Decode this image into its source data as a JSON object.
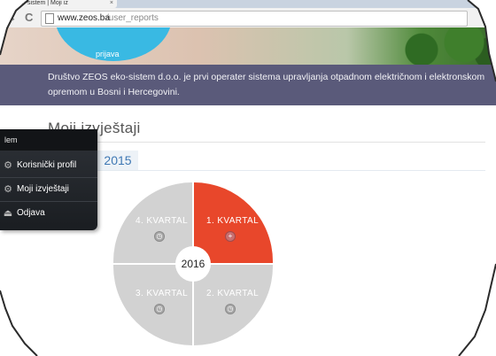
{
  "browser": {
    "tab_title": "s eko-sistem | Moji iz",
    "tab_close": "×",
    "back_glyph": "→",
    "reload_glyph": "C",
    "url_host": "www.zeos.ba",
    "url_path": "/user_reports"
  },
  "hero": {
    "circle_label": "prijava"
  },
  "info": {
    "text": "Društvo ZEOS eko-sistem d.o.o. je prvi operater sistema upravljanja otpadnom električnom i elektronskom opremom u Bosni i Hercegovini."
  },
  "page": {
    "title": "Moji izvještaji",
    "year_tab": "2015"
  },
  "wheel": {
    "center_year": "2016",
    "quarters": {
      "q1": {
        "label": "1. KVARTAL",
        "icon": "+",
        "color": "#e8472b",
        "icon_name": "plus-icon"
      },
      "q2": {
        "label": "2. KVARTAL",
        "icon": "◷",
        "color": "#d2d2d2",
        "icon_name": "history-icon"
      },
      "q3": {
        "label": "3. KVARTAL",
        "icon": "◷",
        "color": "#d2d2d2",
        "icon_name": "history-icon"
      },
      "q4": {
        "label": "4. KVARTAL",
        "icon": "◷",
        "color": "#d2d2d2",
        "icon_name": "history-icon"
      }
    }
  },
  "user_menu": {
    "header": "lem",
    "items": [
      {
        "label": "Korisnički profil",
        "icon": "⚙",
        "icon_name": "profile-gear-icon"
      },
      {
        "label": "Moji izvještaji",
        "icon": "⚙",
        "icon_name": "reports-gear-icon"
      },
      {
        "label": "Odjava",
        "icon": "⏏",
        "icon_name": "logout-icon"
      }
    ]
  },
  "colors": {
    "accent_red": "#e8472b",
    "info_bar": "#5a5a7a",
    "year_link": "#3f78b4"
  }
}
